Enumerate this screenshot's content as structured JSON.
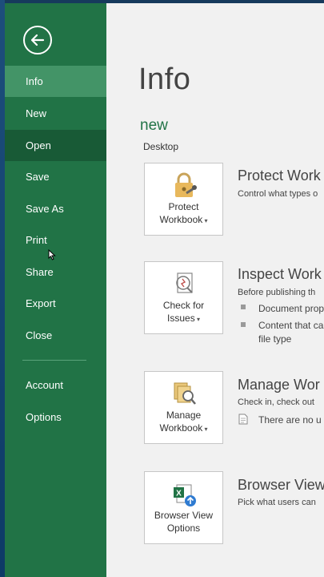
{
  "sidebar": {
    "items": [
      {
        "label": "Info"
      },
      {
        "label": "New"
      },
      {
        "label": "Open"
      },
      {
        "label": "Save"
      },
      {
        "label": "Save As"
      },
      {
        "label": "Print"
      },
      {
        "label": "Share"
      },
      {
        "label": "Export"
      },
      {
        "label": "Close"
      },
      {
        "label": "Account"
      },
      {
        "label": "Options"
      }
    ],
    "active": "Info"
  },
  "main": {
    "title": "Info",
    "doc_name": "new",
    "location": "Desktop",
    "sections": [
      {
        "tile_label_1": "Protect",
        "tile_label_2": "Workbook",
        "heading": "Protect Work",
        "description": "Control what types o"
      },
      {
        "tile_label_1": "Check for",
        "tile_label_2": "Issues",
        "heading": "Inspect Work",
        "description": "Before publishing th",
        "bullets": [
          "Document prop",
          "Content that ca"
        ],
        "bullet_continuation": "file type"
      },
      {
        "tile_label_1": "Manage",
        "tile_label_2": "Workbook",
        "heading": "Manage Wor",
        "description": "Check in, check out",
        "note": "There are no u"
      },
      {
        "tile_label_1": "Browser View",
        "tile_label_2": "Options",
        "heading": "Browser View",
        "description": "Pick what users can"
      }
    ]
  },
  "colors": {
    "sidebar": "#217346",
    "sidebar_active": "#439467",
    "sidebar_hover": "#185a36",
    "main_bg": "#f1f1f1",
    "accent_text": "#217346"
  }
}
